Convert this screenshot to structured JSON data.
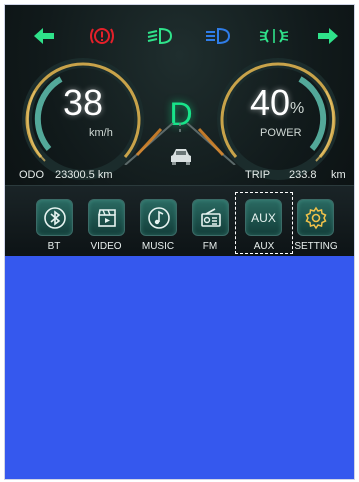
{
  "telltales": {
    "left_arrow": "left-turn-signal",
    "brake_warning": "brake-warning",
    "low_beam": "low-beam",
    "high_beam": "high-beam",
    "fog_light": "fog-light",
    "right_arrow": "right-turn-signal"
  },
  "colors": {
    "green": "#2fe28a",
    "red": "#e3202a",
    "blue": "#2f7de8",
    "gauge_gold": "#c8a34a",
    "gauge_teal": "#5fc2b0",
    "background_blue": "#3558ee"
  },
  "speed": {
    "value": "38",
    "unit": "km/h"
  },
  "power": {
    "value": "40",
    "percent": "%",
    "label": "POWER",
    "level": 0.4
  },
  "gear": "D",
  "odo": {
    "label": "ODO",
    "value": "23300.5 km"
  },
  "trip": {
    "label": "TRIP",
    "value": "233.8",
    "unit": "km"
  },
  "media": {
    "items": [
      {
        "label": "BT",
        "icon": "bluetooth-icon"
      },
      {
        "label": "VIDEO",
        "icon": "video-clapper-icon"
      },
      {
        "label": "MUSIC",
        "icon": "music-note-icon"
      },
      {
        "label": "FM",
        "icon": "radio-icon"
      },
      {
        "label": "AUX",
        "tile_text": "AUX",
        "icon": "aux-icon"
      },
      {
        "label": "SETTING",
        "icon": "gear-icon"
      }
    ]
  }
}
